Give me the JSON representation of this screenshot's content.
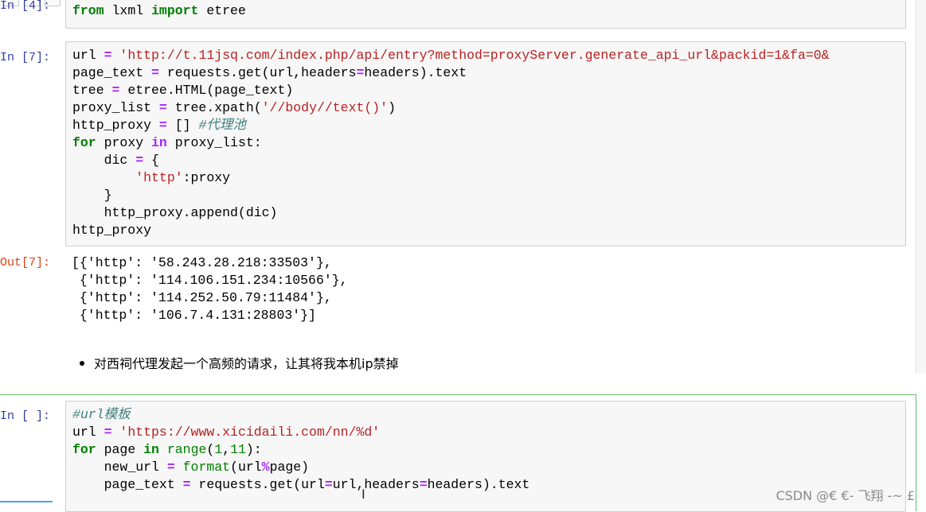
{
  "cells": {
    "c4": {
      "prompt": "In [4]:",
      "line": "from lxml import etree"
    },
    "c7": {
      "prompt": "In [7]:",
      "out_prompt": "Out[7]:",
      "output_lines": [
        "[{'http': '58.243.28.218:33503'},",
        " {'http': '114.106.151.234:10566'},",
        " {'http': '114.252.50.79:11484'},",
        " {'http': '106.7.4.131:28803'}]"
      ]
    },
    "markdown": {
      "bullet_text": "对西祠代理发起一个高频的请求，让其将我本机ip禁掉"
    },
    "c_new": {
      "prompt": "In [ ]:"
    }
  },
  "watermark": "CSDN @€ €- 飞翔 -~ £",
  "colors": {
    "keyword": "#008000",
    "operator": "#aa22ff",
    "string": "#ba2121",
    "comment": "#408080",
    "in_prompt": "#303f9f",
    "out_prompt": "#d84315",
    "selected_border": "#66bb6a"
  }
}
